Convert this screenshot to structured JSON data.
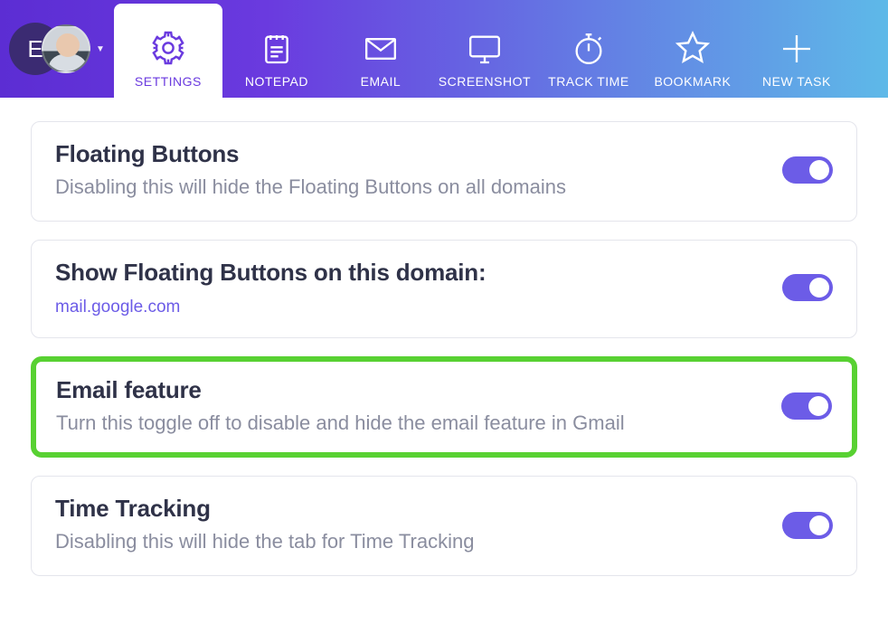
{
  "workspace_initial": "E",
  "tabs": {
    "settings": "SETTINGS",
    "notepad": "NOTEPAD",
    "email": "EMAIL",
    "screenshot": "SCREENSHOT",
    "tracktime": "TRACK TIME",
    "bookmark": "BOOKMARK",
    "newtask": "NEW TASK"
  },
  "settings": {
    "floating_buttons": {
      "title": "Floating Buttons",
      "desc": "Disabling this will hide the Floating Buttons on all domains"
    },
    "show_domain": {
      "title": "Show Floating Buttons on this domain:",
      "domain": "mail.google.com"
    },
    "email_feature": {
      "title": "Email feature",
      "desc": "Turn this toggle off to disable and hide the email feature in Gmail"
    },
    "time_tracking": {
      "title": "Time Tracking",
      "desc": "Disabling this will hide the tab for Time Tracking"
    }
  }
}
